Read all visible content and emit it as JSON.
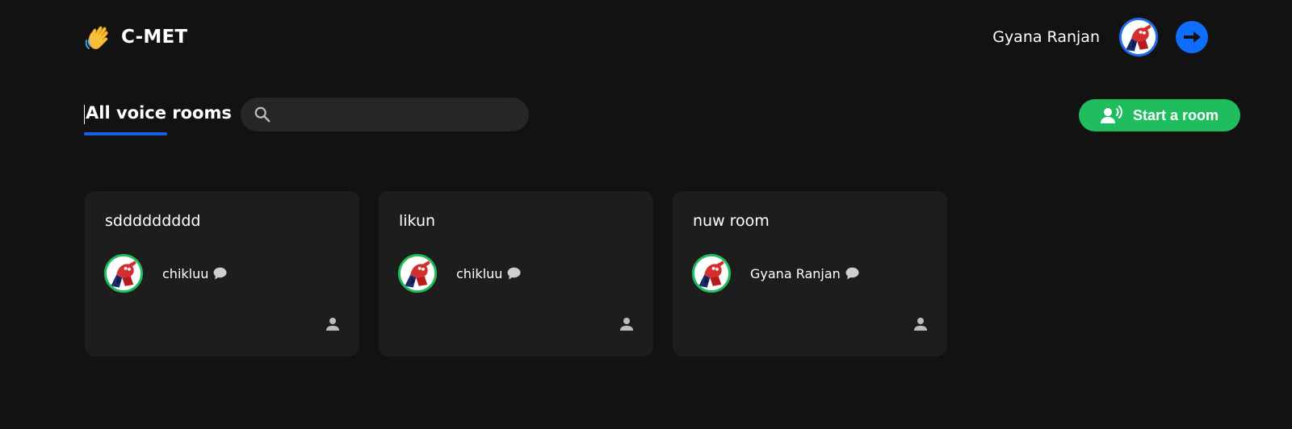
{
  "header": {
    "logo_icon": "waving-hand-icon",
    "brand": "C-MET",
    "user_name": "Gyana Ranjan",
    "avatar_icon": "spiderman-avatar",
    "logout_icon": "arrow-right-icon"
  },
  "toolbar": {
    "title": "All voice rooms",
    "search": {
      "value": "",
      "placeholder": ""
    },
    "start_room_label": "Start a room"
  },
  "rooms": [
    {
      "topic": "sddddddddd",
      "speaker": "chikluu"
    },
    {
      "topic": "likun",
      "speaker": "chikluu"
    },
    {
      "topic": "nuw room",
      "speaker": "Gyana Ranjan"
    }
  ],
  "colors": {
    "background": "#121212",
    "card": "#1d1d1d",
    "accent_blue": "#0d6efd",
    "accent_green": "#20bd5f"
  }
}
